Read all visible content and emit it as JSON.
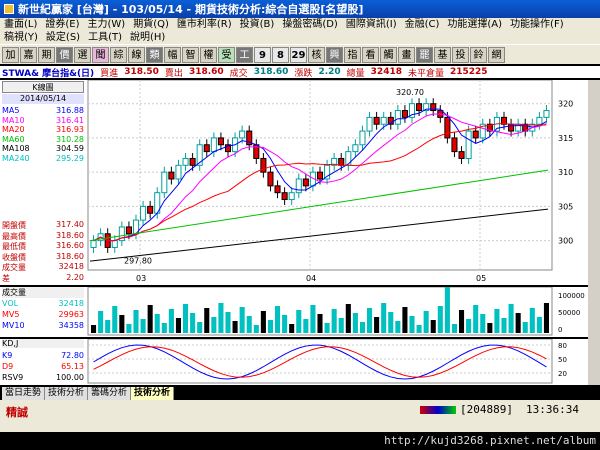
{
  "window": {
    "title": "新世紀贏家 [台灣] - 103/05/14 - 期貨技術分析:綜合自選股[名望股]"
  },
  "menu": [
    "畫面(L)",
    "證券(E)",
    "主力(W)",
    "期貨(Q)",
    "匯市利率(R)",
    "投資(B)",
    "操盤密碼(D)",
    "國際資訊(I)",
    "金融(C)",
    "功能選擇(A)",
    "功能操作(F)",
    "稿視(Y)",
    "設定(S)",
    "工具(T)",
    "說明(H)"
  ],
  "toolbar": [
    "加",
    "嘉",
    "期",
    "價",
    "選",
    "聞",
    "綜",
    "線",
    "類",
    "幅",
    "智",
    "權",
    "受",
    "工",
    "9",
    "8",
    "29",
    "核",
    "興",
    "指",
    "看",
    "觸",
    "畫",
    "罷",
    "基",
    "投",
    "鈴",
    "網"
  ],
  "quote": {
    "symbol": "STWA& 摩台指&(日)",
    "bid_label": "買進",
    "bid": "318.50",
    "ask_label": "賣出",
    "ask": "318.60",
    "last_label": "成交",
    "last": "318.60",
    "chg_label": "漲跌",
    "chg": "2.20",
    "vol_label": "總量",
    "vol": "32418",
    "oi_label": "未平倉量",
    "oi": "215225"
  },
  "price_panel": {
    "label": "K線圖",
    "date": "2014/05/14",
    "ma": [
      {
        "name": "MA5",
        "value": "316.88",
        "color": "#0000ff"
      },
      {
        "name": "MA10",
        "value": "316.41",
        "color": "#ff00ff"
      },
      {
        "name": "MA20",
        "value": "316.93",
        "color": "#ff0000"
      },
      {
        "name": "MA60",
        "value": "310.28",
        "color": "#00c000"
      },
      {
        "name": "MA108",
        "value": "304.59",
        "color": "#000000"
      },
      {
        "name": "MA240",
        "value": "295.29",
        "color": "#00c0c0"
      }
    ],
    "ohlc": [
      {
        "name": "開盤價",
        "value": "317.40"
      },
      {
        "name": "最高價",
        "value": "318.60"
      },
      {
        "name": "最低價",
        "value": "316.60"
      },
      {
        "name": "收盤價",
        "value": "318.60"
      },
      {
        "name": "成交量",
        "value": "32418"
      },
      {
        "name": "差",
        "value": "2.20"
      }
    ],
    "high_label": "320.70",
    "low_label": "297.80",
    "y_ticks": [
      "320",
      "315",
      "310",
      "305",
      "300"
    ],
    "x_ticks": [
      "03",
      "04",
      "05"
    ]
  },
  "volume_panel": {
    "label": "成交量",
    "rows": [
      {
        "name": "VOL",
        "value": "32418",
        "color": "#00c0c0"
      },
      {
        "name": "MV5",
        "value": "29963",
        "color": "#ff0000"
      },
      {
        "name": "MV10",
        "value": "34358",
        "color": "#0000ff"
      }
    ],
    "y_ticks": [
      "100000",
      "50000",
      "0"
    ]
  },
  "kd_panel": {
    "label": "KD,J",
    "rows": [
      {
        "name": "K9",
        "value": "72.80",
        "color": "#0000ff"
      },
      {
        "name": "D9",
        "value": "65.13",
        "color": "#ff0000"
      },
      {
        "name": "RSV9",
        "value": "100.00",
        "color": "#000000"
      }
    ],
    "y_ticks": [
      "80",
      "50",
      "20"
    ]
  },
  "tabs": [
    "當日走勢",
    "技術分析",
    "籌碼分析",
    "技術分析"
  ],
  "status": {
    "left": "精誠",
    "code": "204889",
    "time": "13:36:34"
  },
  "url": "http://kujd3268.pixnet.net/album"
}
